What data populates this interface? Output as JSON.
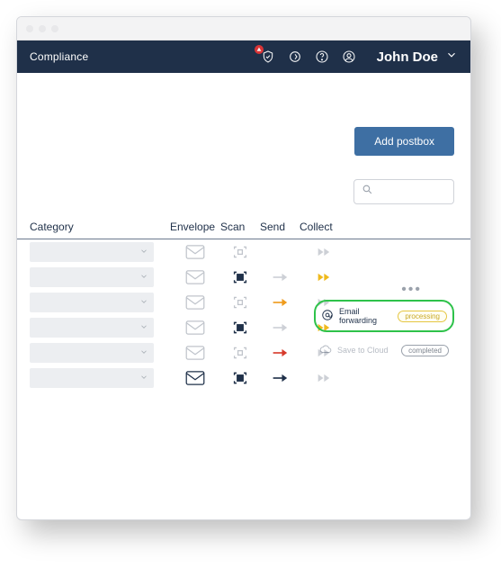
{
  "header": {
    "title": "Compliance",
    "user_name": "John Doe"
  },
  "actions": {
    "add_postbox": "Add postbox"
  },
  "search": {
    "placeholder": ""
  },
  "columns": {
    "category": "Category",
    "envelope": "Envelope",
    "scan": "Scan",
    "send": "Send",
    "collect": "Collect"
  },
  "rows": [
    {
      "envelope": "disabled",
      "scan": "disabled",
      "send": "none",
      "collect": "disabled"
    },
    {
      "envelope": "disabled",
      "scan": "active",
      "send": "disabled",
      "collect": "amber"
    },
    {
      "envelope": "disabled",
      "scan": "disabled",
      "send": "amber",
      "collect": "disabled"
    },
    {
      "envelope": "disabled",
      "scan": "active",
      "send": "disabled",
      "collect": "amber"
    },
    {
      "envelope": "disabled",
      "scan": "disabled",
      "send": "red",
      "collect": "disabled"
    },
    {
      "envelope": "active",
      "scan": "active",
      "send": "active",
      "collect": "disabled"
    }
  ],
  "panel": {
    "email_forwarding": {
      "label": "Email forwarding",
      "status": "processing"
    },
    "save_to_cloud": {
      "label": "Save to Cloud",
      "status": "completed"
    }
  }
}
